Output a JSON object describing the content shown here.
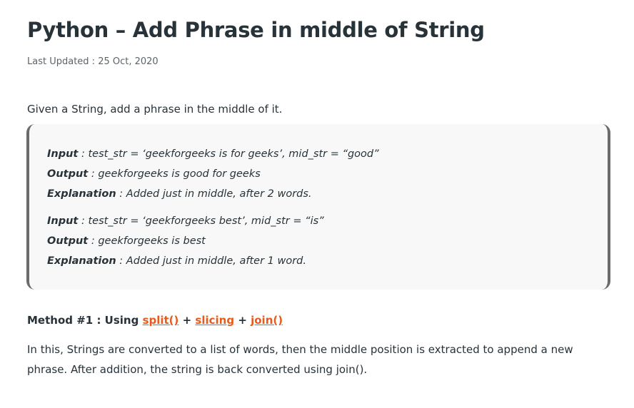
{
  "article": {
    "title": "Python – Add Phrase in middle of String",
    "last_updated": "Last Updated : 25 Oct, 2020",
    "intro": "Given a String, add a phrase in the middle of it."
  },
  "examples": [
    {
      "input_label": "Input",
      "input_text": " : test_str = ‘geekforgeeks is for geeks’, mid_str = “good”",
      "output_label": "Output",
      "output_text": " : geekforgeeks is good for geeks",
      "explanation_label": "Explanation",
      "explanation_text": " : Added just in middle, after 2 words."
    },
    {
      "input_label": "Input",
      "input_text": " : test_str = ‘geekforgeeks best’, mid_str = “is”",
      "output_label": "Output",
      "output_text": " : geekforgeeks is best",
      "explanation_label": "Explanation",
      "explanation_text": " : Added just in middle, after 1 word."
    }
  ],
  "method": {
    "prefix": "Method #1 : Using ",
    "link1": "split()",
    "sep1": " + ",
    "link2": "slicing",
    "sep2": " + ",
    "link3": "join()"
  },
  "description": "In this, Strings are converted to a list of words, then the middle position is extracted to append a new phrase. After addition, the string is back converted using join().",
  "colors": {
    "text": "#273239",
    "link": "#e65a1c",
    "box_bg": "#f8f8f8",
    "box_border": "#6b6b6b"
  }
}
